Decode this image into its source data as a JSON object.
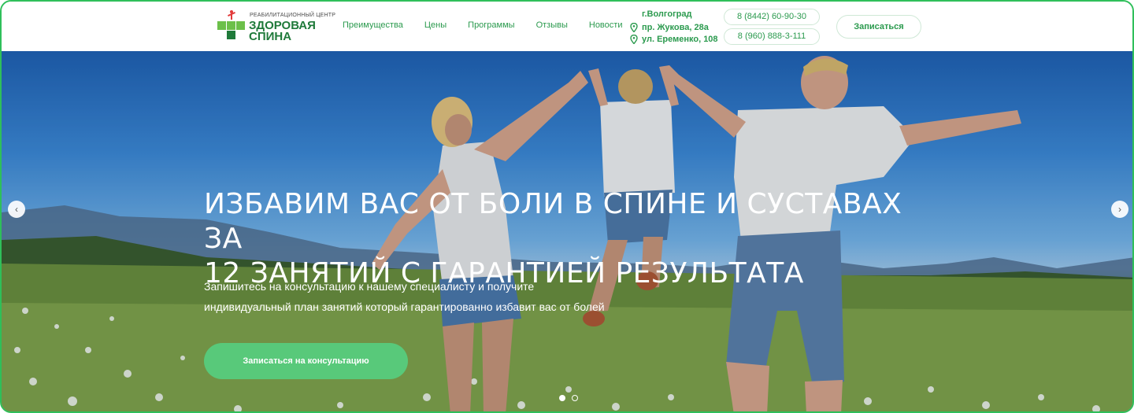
{
  "header": {
    "logo": {
      "kicker": "РЕАБИЛИТАЦИОННЫЙ ЦЕНТР",
      "line1": "ЗДОРОВАЯ",
      "line2": "СПИНА"
    },
    "nav": [
      "Преимущества",
      "Цены",
      "Программы",
      "Отзывы",
      "Новости"
    ],
    "address": {
      "city": "г.Волгоград",
      "locations": [
        "пр. Жукова, 28а",
        "ул. Еременко, 108"
      ]
    },
    "phones": [
      "8 (8442) 60-90-30",
      "8 (960) 888-3-111"
    ],
    "signup_label": "Записаться"
  },
  "hero": {
    "title_line1": "ИЗБАВИМ ВАС ОТ БОЛИ В СПИНЕ И СУСТАВАХ ЗА",
    "title_line2": "12 ЗАНЯТИЙ С ГАРАНТИЕЙ РЕЗУЛЬТАТА",
    "subtitle_line1": "Запишитесь на консультацию к нашему специалисту и получите",
    "subtitle_line2": "индивидуальный план занятий который гарантированно избавит вас от болей",
    "cta_label": "Записаться на консультацию",
    "slides_total": 2,
    "slide_active": 1
  },
  "icons": {
    "location": "location-pin-icon",
    "prev": "chevron-left-icon",
    "next": "chevron-right-icon"
  },
  "colors": {
    "brand_green": "#2b9a4e",
    "cta_green": "#58c97a",
    "frame_green": "#2fbf5a"
  }
}
